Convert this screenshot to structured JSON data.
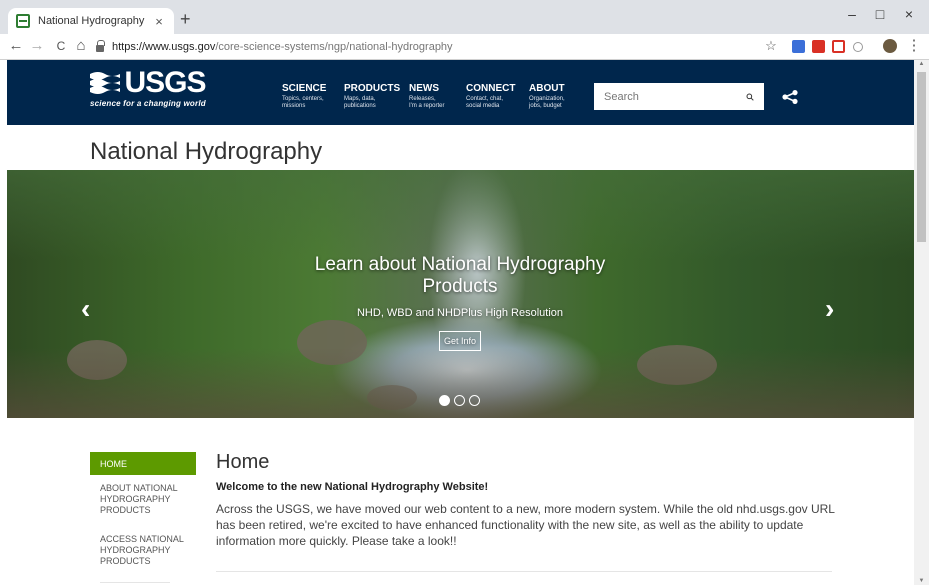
{
  "browser": {
    "tab_title": "National Hydrography",
    "tab_close": "×",
    "new_tab": "+",
    "url_host": "https://www.usgs.gov",
    "url_path": "/core-science-systems/ngp/national-hydrography",
    "back": "←",
    "forward": "→",
    "reload": "C",
    "home": "⌂",
    "star": "☆",
    "minimize": "–",
    "maximize": "□",
    "close": "×",
    "menu": "⋮"
  },
  "header": {
    "logo_text": "USGS",
    "logo_tagline": "science for a changing world",
    "nav": [
      {
        "title": "SCIENCE",
        "sub1": "Topics, centers,",
        "sub2": "missions"
      },
      {
        "title": "PRODUCTS",
        "sub1": "Maps, data,",
        "sub2": "publications"
      },
      {
        "title": "NEWS",
        "sub1": "Releases,",
        "sub2": "I'm a reporter"
      },
      {
        "title": "CONNECT",
        "sub1": "Contact, chat,",
        "sub2": "social media"
      },
      {
        "title": "ABOUT",
        "sub1": "Organization,",
        "sub2": "jobs, budget"
      }
    ],
    "search_placeholder": "Search"
  },
  "page": {
    "title": "National Hydrography"
  },
  "carousel": {
    "title_line1": "Learn about National Hydrography",
    "title_line2": "Products",
    "subtitle": "NHD, WBD and NHDPlus High Resolution",
    "button": "Get Info",
    "prev": "‹",
    "next": "›"
  },
  "sidebar": {
    "items": [
      {
        "label": "HOME"
      },
      {
        "label": "ABOUT NATIONAL HYDROGRAPHY PRODUCTS"
      },
      {
        "label": "ACCESS NATIONAL HYDROGRAPHY PRODUCTS"
      }
    ]
  },
  "main": {
    "heading": "Home",
    "subheading": "Welcome to the new National Hydrography Website!",
    "body": "Across the USGS, we have moved our web content to a new, more modern system. While the old nhd.usgs.gov URL has been retired, we're excited to have enhanced functionality with the new site, as well as the ability to update information more quickly. Please take a look!!"
  },
  "colors": {
    "header_bg": "#00264c",
    "sidebar_active": "#5d9a00"
  }
}
